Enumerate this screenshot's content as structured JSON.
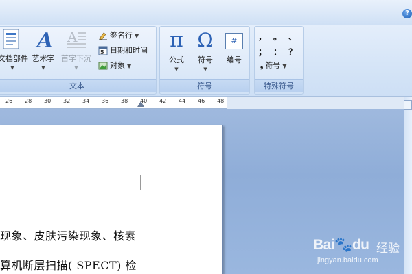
{
  "window": {
    "help_glyph": "?"
  },
  "ribbon": {
    "text_group": {
      "label": "文本",
      "buttons": [
        {
          "label": "文档部件",
          "icon": "document-parts-icon"
        },
        {
          "label": "艺术字",
          "icon": "wordart-icon"
        },
        {
          "label": "首字下沉",
          "icon": "drop-cap-icon",
          "disabled": true
        }
      ],
      "small_buttons": [
        {
          "label": "签名行",
          "icon": "signature-line-icon"
        },
        {
          "label": "日期和时间",
          "icon": "date-time-icon"
        },
        {
          "label": "对象",
          "icon": "object-icon"
        }
      ]
    },
    "symbols_group": {
      "label": "符号",
      "buttons": [
        {
          "label": "公式",
          "glyph": "π",
          "icon": "equation-pi-icon"
        },
        {
          "label": "符号",
          "glyph": "Ω",
          "icon": "symbol-omega-icon"
        },
        {
          "label": "编号",
          "glyph": "#",
          "icon": "number-icon"
        }
      ]
    },
    "special_symbols_group": {
      "label": "特殊符号",
      "symbols": [
        "，",
        "。",
        "、",
        "；",
        "：",
        "？"
      ],
      "button": {
        "label": "符号",
        "glyph": "❟"
      }
    }
  },
  "ruler": {
    "ticks": [
      "26",
      "28",
      "30",
      "32",
      "34",
      "36",
      "38",
      "40",
      "42",
      "44",
      "46",
      "48"
    ]
  },
  "document": {
    "lines": [
      "现象、皮肤污染现象、核素",
      "算机断层扫描( SPECT) 检"
    ]
  },
  "watermark": {
    "logo": "Bai🐾du",
    "suffix": "经验",
    "url": "jingyan.baidu.com"
  },
  "colors": {
    "ribbon_bg": "#d6e5f7",
    "workspace_bg": "#9fb9de",
    "group_label_text": "#3b5b8e"
  }
}
